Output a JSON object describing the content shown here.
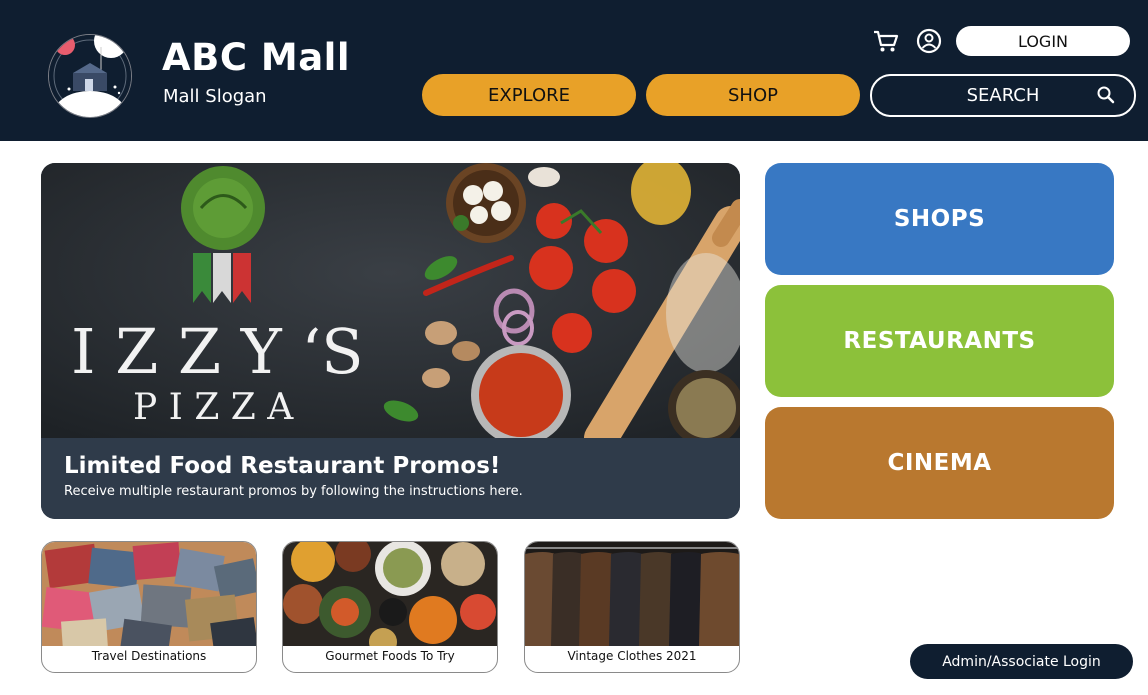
{
  "header": {
    "brand_title": "ABC Mall",
    "brand_slogan": "Mall Slogan",
    "nav": {
      "explore": "EXPLORE",
      "shop": "SHOP"
    },
    "search_label": "SEARCH",
    "login_label": "LOGIN",
    "icons": {
      "cart": "cart-icon",
      "account": "user-circle-icon",
      "search": "search-icon"
    }
  },
  "hero": {
    "image_text_line1": "I Z Z Y ‘S",
    "image_text_line2": "P I Z Z A",
    "title": "Limited Food Restaurant Promos!",
    "subtitle": "Receive multiple restaurant promos by following the instructions here."
  },
  "categories": [
    {
      "label": "SHOPS",
      "color": "#3878c3"
    },
    {
      "label": "RESTAURANTS",
      "color": "#8cc13a"
    },
    {
      "label": "CINEMA",
      "color": "#b9782f"
    }
  ],
  "cards": [
    {
      "label": "Travel Destinations"
    },
    {
      "label": "Gourmet Foods To Try"
    },
    {
      "label": "Vintage Clothes 2021"
    }
  ],
  "admin_label": "Admin/Associate Login",
  "colors": {
    "header_bg": "#0f1e30",
    "nav_button": "#e8a128",
    "caption_bg": "#2f3b4a"
  }
}
